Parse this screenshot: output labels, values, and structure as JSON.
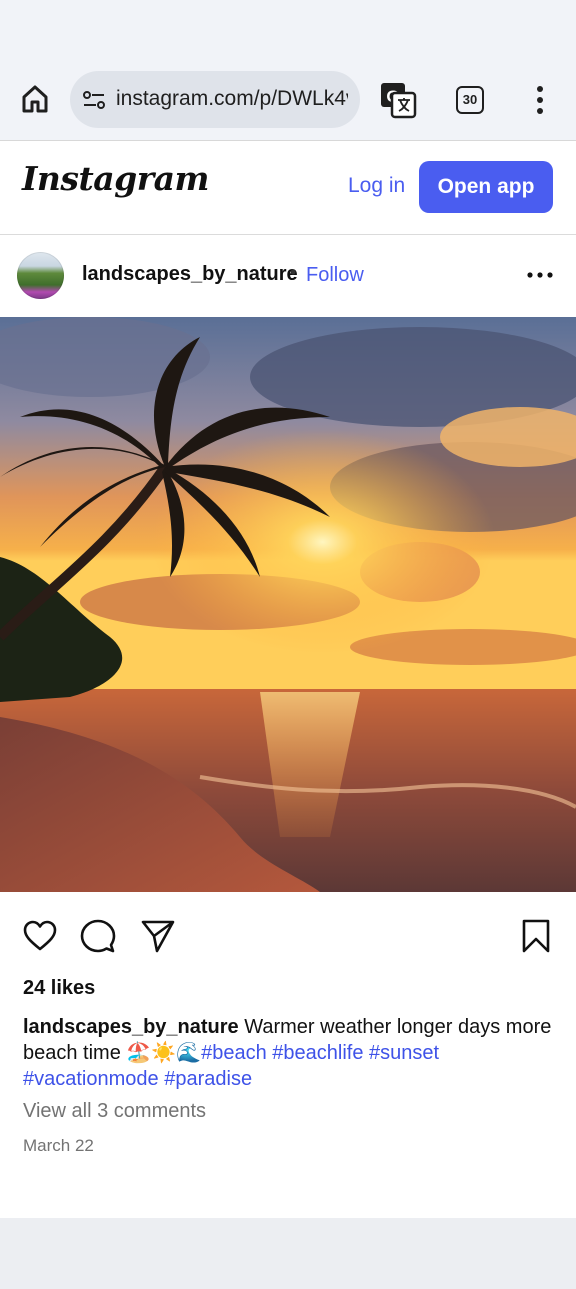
{
  "browser": {
    "url": "instagram.com/p/DWLk4v",
    "tab_count": "30",
    "icons": [
      "home-icon",
      "site-settings-icon",
      "translate-icon",
      "tabs-icon",
      "more-vert-icon"
    ]
  },
  "header": {
    "logo": "Instagram",
    "login_label": "Log in",
    "open_app_label": "Open app",
    "accent_color": "#4a5df0"
  },
  "post": {
    "username": "landscapes_by_nature",
    "separator": "•",
    "follow_label": "Follow",
    "likes": "24 likes",
    "caption": {
      "username": "landscapes_by_nature",
      "text": " Warmer weather longer days more beach time 🏖️☀️🌊",
      "hashtags": [
        "#beach",
        "#beachlife",
        "#sunset",
        "#vacationmode",
        "#paradise"
      ]
    },
    "view_comments": "View all 3 comments",
    "date": "March 22"
  }
}
